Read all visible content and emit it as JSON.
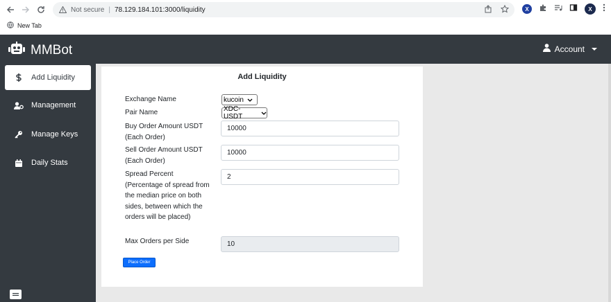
{
  "browser": {
    "not_secure": "Not secure",
    "separator": "|",
    "url": "78.129.184.101:3000/liquidity",
    "extension_letter": "X",
    "profile_letter": "X",
    "bookmark": "New Tab"
  },
  "navbar": {
    "brand": "MMBot",
    "account": "Account"
  },
  "sidebar": {
    "items": [
      {
        "label": "Add Liquidity",
        "icon": "dollar-icon",
        "active": true
      },
      {
        "label": "Management",
        "icon": "user-cog-icon",
        "active": false
      },
      {
        "label": "Manage Keys",
        "icon": "key-icon",
        "active": false
      },
      {
        "label": "Daily Stats",
        "icon": "calendar-icon",
        "active": false
      }
    ]
  },
  "form": {
    "title": "Add Liquidity",
    "exchange_label": "Exchange Name",
    "exchange_value": "kucoin",
    "pair_label": "Pair Name",
    "pair_value": "XDC-USDT",
    "buy_label": "Buy Order Amount USDT (Each Order)",
    "buy_value": "10000",
    "sell_label": "Sell Order Amount USDT (Each Order)",
    "sell_value": "10000",
    "spread_label": "Spread Percent (Percentage of spread from the median price on both sides, between which the orders will be placed)",
    "spread_value": "2",
    "max_label": "Max Orders per Side",
    "max_value": "10",
    "submit": "Place Order"
  },
  "colors": {
    "navbar_bg": "#343a40",
    "primary": "#0d6efd",
    "content_bg": "#e9e9e9"
  }
}
